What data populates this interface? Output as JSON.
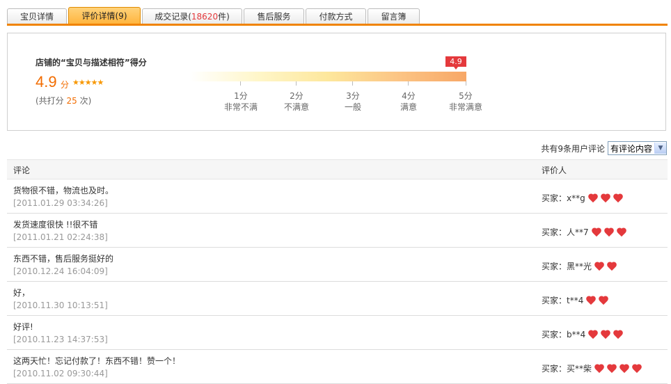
{
  "tabs": [
    {
      "label": "宝贝详情",
      "active": false
    },
    {
      "label": "评价详情(9)",
      "active": true
    },
    {
      "label_prefix": "成交记录(",
      "label_num": "18620",
      "label_suffix": "件)",
      "active": false
    },
    {
      "label": "售后服务",
      "active": false
    },
    {
      "label": "付款方式",
      "active": false
    },
    {
      "label": "留言簿",
      "active": false
    }
  ],
  "rating": {
    "title": "店铺的“宝贝与描述相符”得分",
    "score": "4.9",
    "unit": "分",
    "stars": "★★★★★",
    "total_prefix": "(共打分",
    "total_count": "25",
    "total_suffix": "次)",
    "bar_value": 4.9,
    "bar_label": "4.9",
    "scale": [
      {
        "value": "1分",
        "desc": "非常不满"
      },
      {
        "value": "2分",
        "desc": "不满意"
      },
      {
        "value": "3分",
        "desc": "一般"
      },
      {
        "value": "4分",
        "desc": "满意"
      },
      {
        "value": "5分",
        "desc": "非常满意"
      }
    ]
  },
  "filter": {
    "count_text": "共有9条用户评论",
    "selected": "有评论内容"
  },
  "table": {
    "col_comment": "评论",
    "col_reviewer": "评价人",
    "rows": [
      {
        "text": "货物很不错，物流也及时。",
        "time": "[2011.01.29 03:34:26]",
        "buyer": "买家：x**g",
        "hearts": 3
      },
      {
        "text": "发货速度很快 !!很不错",
        "time": "[2011.01.21 02:24:38]",
        "buyer": "买家：人**7",
        "hearts": 3
      },
      {
        "text": "东西不错，售后服务挺好的",
        "time": "[2010.12.24 16:04:09]",
        "buyer": "买家：黑**光",
        "hearts": 2
      },
      {
        "text": "好，",
        "time": "[2010.11.30 10:13:51]",
        "buyer": "买家：t**4",
        "hearts": 2
      },
      {
        "text": "好评!",
        "time": "[2010.11.23 14:37:53]",
        "buyer": "买家：b**4",
        "hearts": 3
      },
      {
        "text": "这两天忙！忘记付款了！东西不错！赞一个！",
        "time": "[2010.11.02 09:30:44]",
        "buyer": "买家：买**柴",
        "hearts": 4
      }
    ]
  },
  "colors": {
    "accent": "#f08300",
    "score": "#f26c00",
    "heart": "#e4393c"
  }
}
